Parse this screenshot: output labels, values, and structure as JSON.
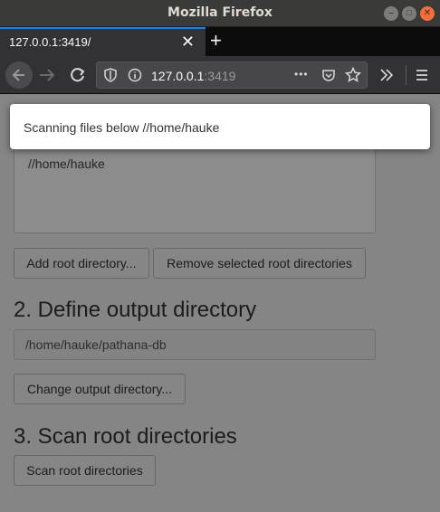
{
  "window": {
    "title": "Mozilla Firefox"
  },
  "tab": {
    "title": "127.0.0.1:3419/",
    "close_glyph": "✕"
  },
  "new_tab_glyph": "+",
  "navbar": {
    "url_host": "127.0.0.1",
    "url_port": ":3419",
    "more_glyph": "•••"
  },
  "page": {
    "root_list": [
      "//home/hauke"
    ],
    "add_root_label": "Add root directory...",
    "remove_root_label": "Remove selected root directories",
    "section2_heading": "2. Define output directory",
    "output_dir_value": "/home/hauke/pathana-db",
    "change_output_label": "Change output directory...",
    "section3_heading": "3. Scan root directories",
    "scan_label": "Scan root directories"
  },
  "dialog": {
    "message": "Scanning files below //home/hauke"
  }
}
